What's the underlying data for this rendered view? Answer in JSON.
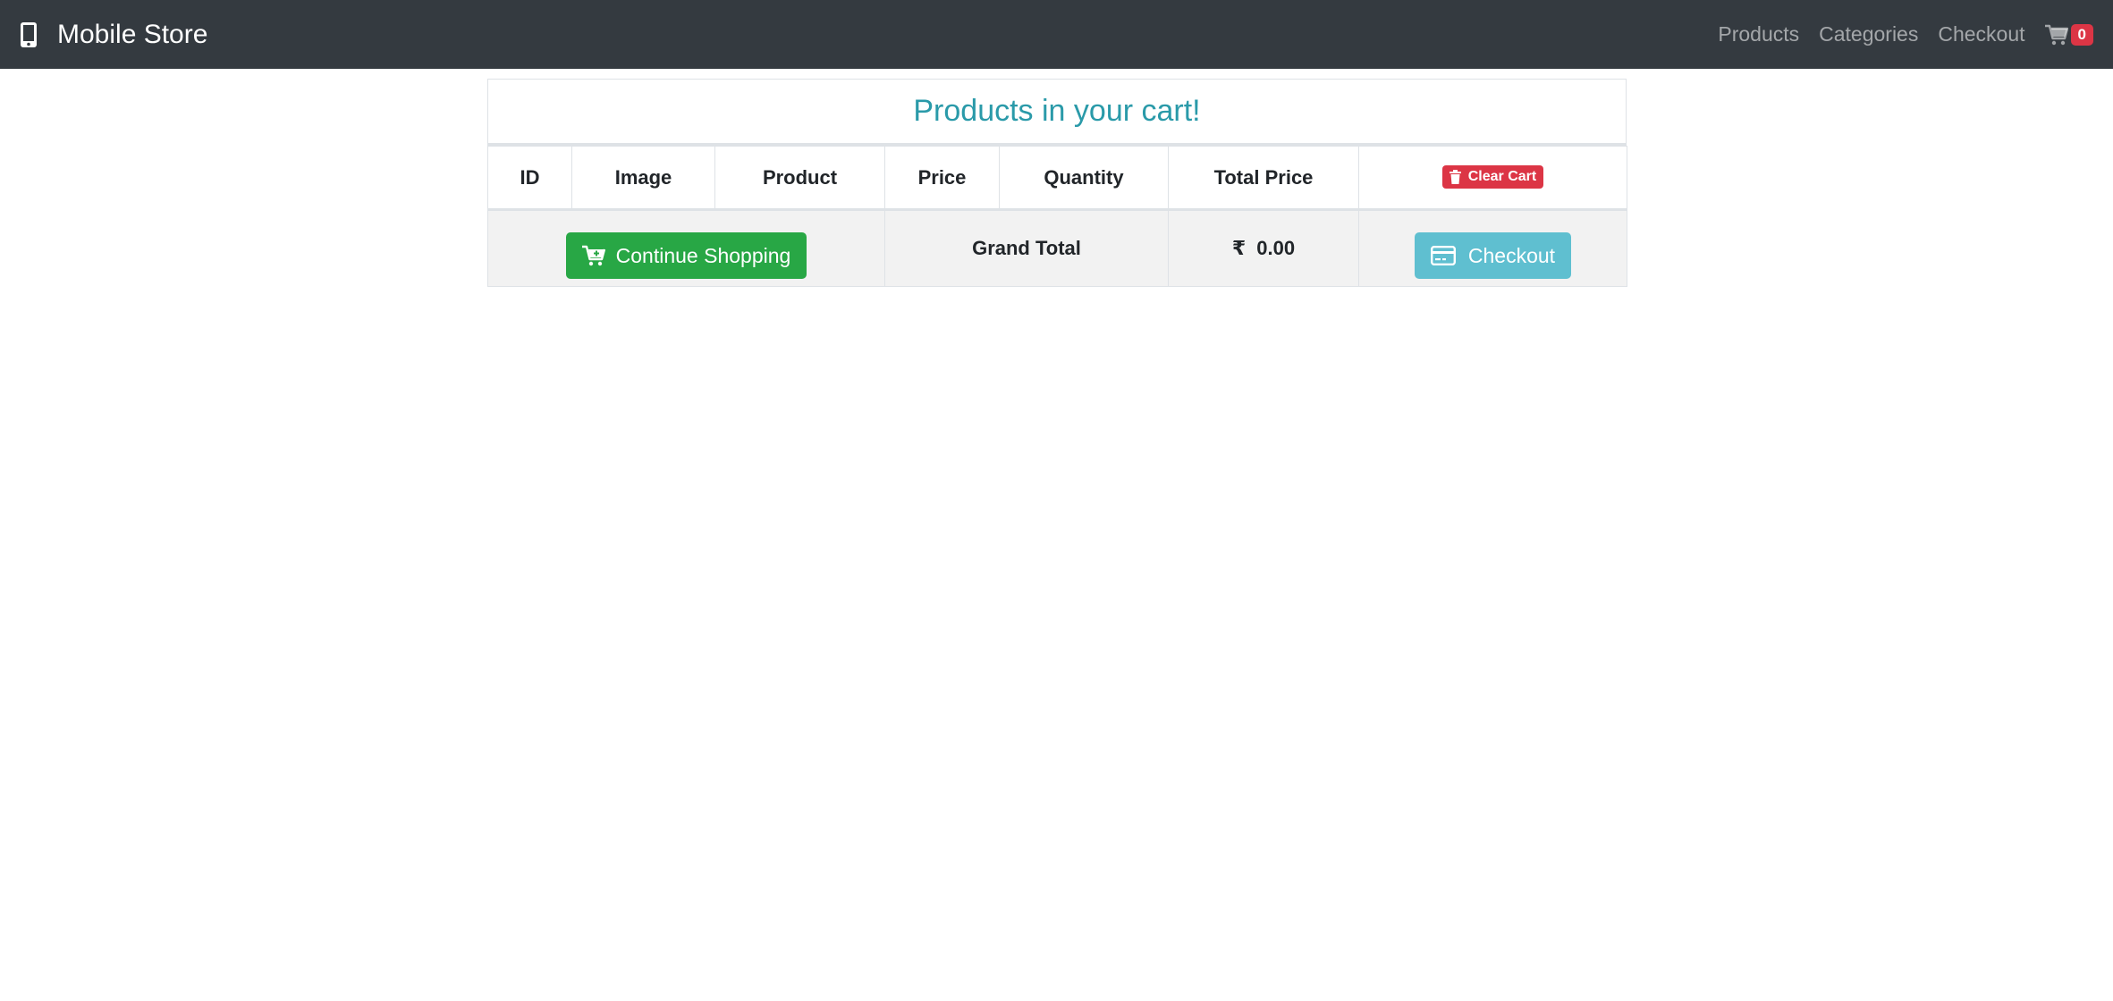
{
  "navbar": {
    "brand": "Mobile Store",
    "brand_icon": "mobile-phone-icon",
    "links": [
      "Products",
      "Categories",
      "Checkout"
    ],
    "cart_icon": "shopping-cart-icon",
    "cart_count": "0"
  },
  "cart": {
    "title": "Products in your cart!",
    "columns": [
      "ID",
      "Image",
      "Product",
      "Price",
      "Quantity",
      "Total Price"
    ],
    "clear_cart_label": "Clear Cart",
    "continue_shopping_label": "Continue Shopping",
    "grand_total_label": "Grand Total",
    "currency_symbol": "₹",
    "grand_total_value": "0.00",
    "checkout_label": "Checkout"
  },
  "colors": {
    "navbar_bg": "#343a40",
    "title": "#2a9aa9",
    "danger": "#dc3545",
    "success": "#28a745",
    "info": "#5fbfd0",
    "footer_row_bg": "#f2f2f2"
  }
}
